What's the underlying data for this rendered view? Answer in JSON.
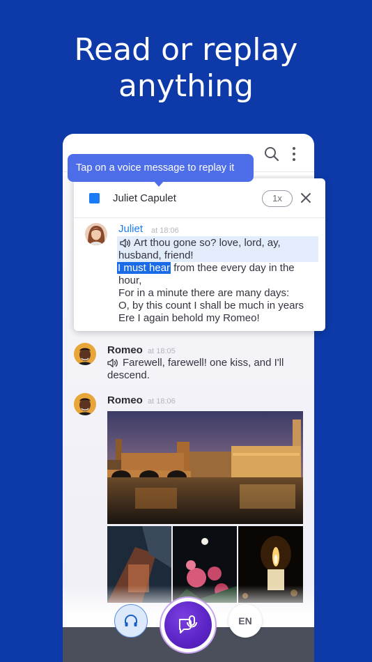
{
  "headline": {
    "line1": "Read or replay",
    "line2": "anything"
  },
  "tooltip": {
    "text": "Tap on a voice message to replay it"
  },
  "player_card": {
    "contact_name": "Juliet Capulet",
    "speed": "1x"
  },
  "messages": [
    {
      "sender": "Juliet",
      "time": "at 18:06",
      "sender_color": "#1a7cf5",
      "lines": [
        "Art thou gone so? love, lord, ay,",
        "husband, friend!",
        "I must hear",
        "from thee every day in the",
        "hour,",
        "For in a minute there are many days:",
        "O, by this count I shall be much in years",
        "Ere I again behold my Romeo!"
      ]
    },
    {
      "sender": "Romeo",
      "time": "at 18:05",
      "sender_color": "#2a2a33",
      "lines": [
        "Farewell, farewell! one kiss, and I'll",
        "descend."
      ]
    },
    {
      "sender": "Romeo",
      "time": "at 18:06",
      "sender_color": "#2a2a33"
    }
  ],
  "bottom_bar": {
    "language": "EN"
  },
  "colors": {
    "background": "#0d3aa8",
    "accent": "#1a7cf5",
    "tooltip": "#4d6ee8",
    "mic_button": "#5a23c4"
  }
}
